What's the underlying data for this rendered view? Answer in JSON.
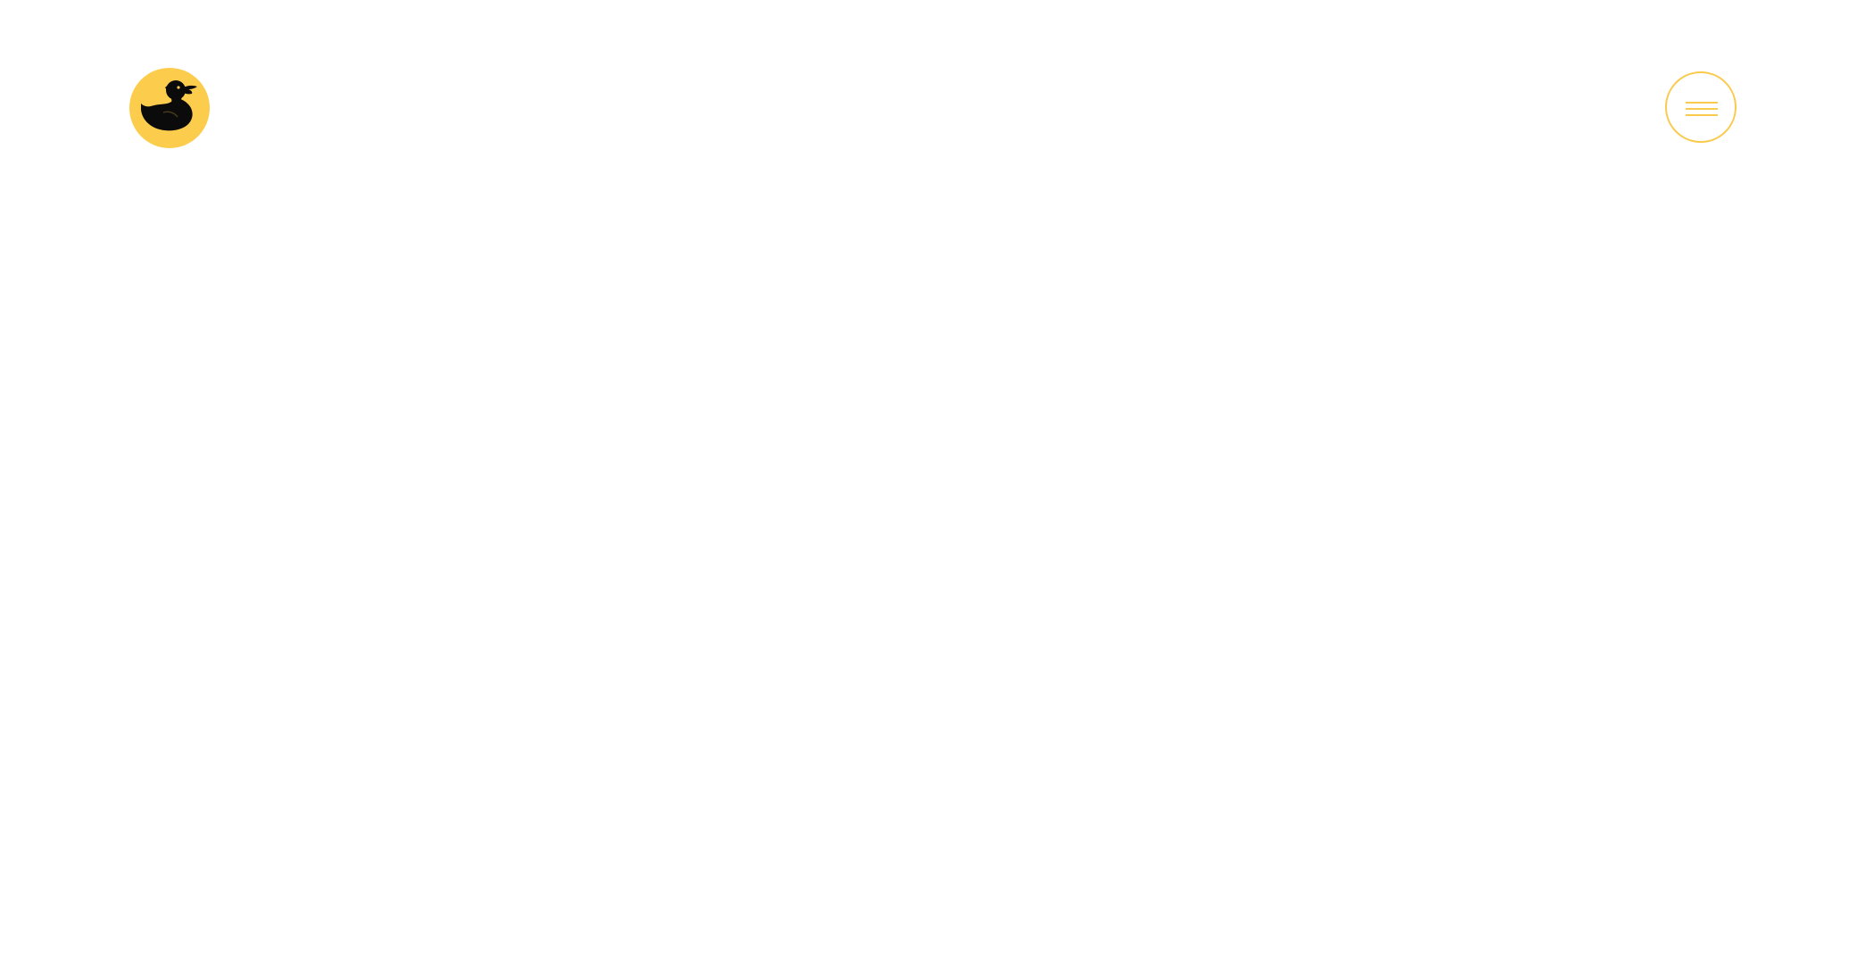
{
  "header": {
    "logo": {
      "icon": "rubber-duck-icon",
      "background_color": "#FCCC4C",
      "duck_color": "#0B0B0B"
    },
    "menu_button": {
      "icon": "hamburger-menu-icon",
      "color": "#F9CA4B"
    }
  },
  "page": {
    "background_color": "#FFFFFF"
  }
}
